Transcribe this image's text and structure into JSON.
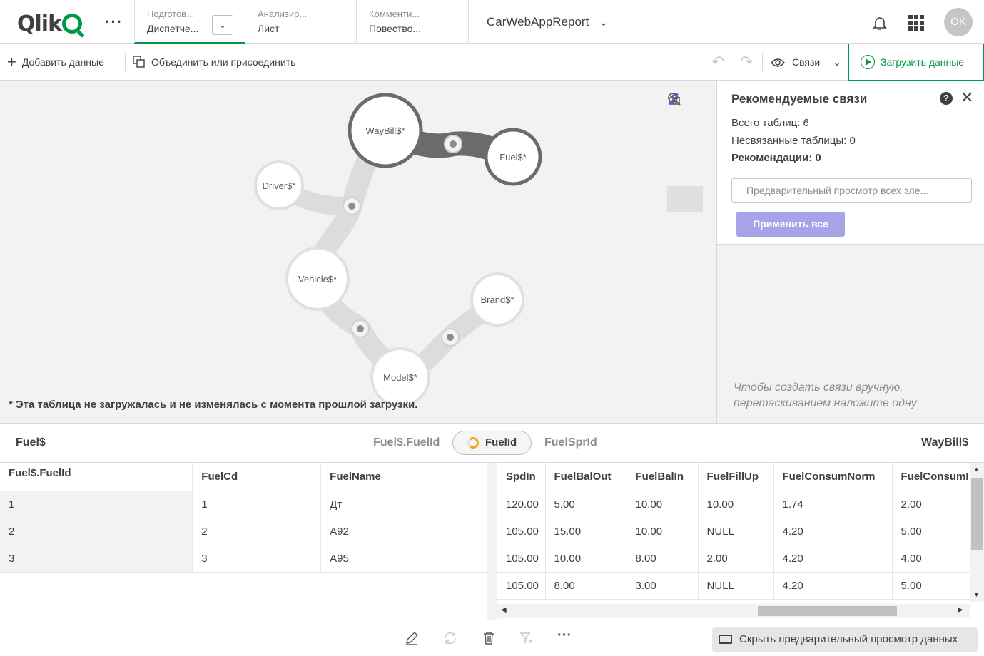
{
  "header": {
    "logo": "Qlik",
    "more_label": "···",
    "tabs": [
      {
        "sub": "Подготов...",
        "main": "Диспетче..."
      },
      {
        "sub": "Анализир...",
        "main": "Лист"
      },
      {
        "sub": "Комменти...",
        "main": "Повество..."
      }
    ],
    "app_name": "CarWebAppReport",
    "avatar_initials": "OK"
  },
  "toolbar": {
    "add_data": "Добавить данные",
    "concat_join": "Объединить или присоединить",
    "associations": "Связи",
    "load_data": "Загрузить данные"
  },
  "model": {
    "nodes": [
      "WayBill$*",
      "Fuel$*",
      "Driver$*",
      "Vehicle$*",
      "Brand$*",
      "Model$*"
    ],
    "footnote": "* Эта таблица не загружалась и не изменялась с момента прошлой загрузки."
  },
  "recommendations": {
    "title": "Рекомендуемые связи",
    "total_tables": "Всего таблиц: 6",
    "unlinked_tables": "Несвязанные таблицы: 0",
    "recommendations_count": "Рекомендации: 0",
    "preview_all": "Предварительный просмотр всех эле...",
    "apply_all": "Применить все",
    "hint": "Чтобы создать связи вручную, перетаскиванием наложите одну"
  },
  "association_bar": {
    "left_table": "Fuel$",
    "field_left": "Fuel$.FuelId",
    "field_selected": "FuelId",
    "field_right": "FuelSprId",
    "right_table": "WayBill$"
  },
  "left_table": {
    "columns": [
      "Fuel$.FuelId",
      "FuelCd",
      "FuelName"
    ],
    "rows": [
      [
        "1",
        "1",
        "Дт"
      ],
      [
        "2",
        "2",
        "А92"
      ],
      [
        "3",
        "3",
        "А95"
      ]
    ]
  },
  "right_table": {
    "columns": [
      "SpdIn",
      "FuelBalOut",
      "FuelBalIn",
      "FuelFillUp",
      "FuelConsumNorm",
      "FuelConsumI"
    ],
    "rows": [
      [
        "120.00",
        "5.00",
        "10.00",
        "10.00",
        "1.74",
        "2.00"
      ],
      [
        "105.00",
        "15.00",
        "10.00",
        "NULL",
        "4.20",
        "5.00"
      ],
      [
        "105.00",
        "10.00",
        "8.00",
        "2.00",
        "4.20",
        "4.00"
      ],
      [
        "105.00",
        "8.00",
        "3.00",
        "NULL",
        "4.20",
        "5.00"
      ]
    ]
  },
  "bottombar": {
    "more_label": "···",
    "hide_preview": "Скрыть предварительный просмотр данных"
  }
}
